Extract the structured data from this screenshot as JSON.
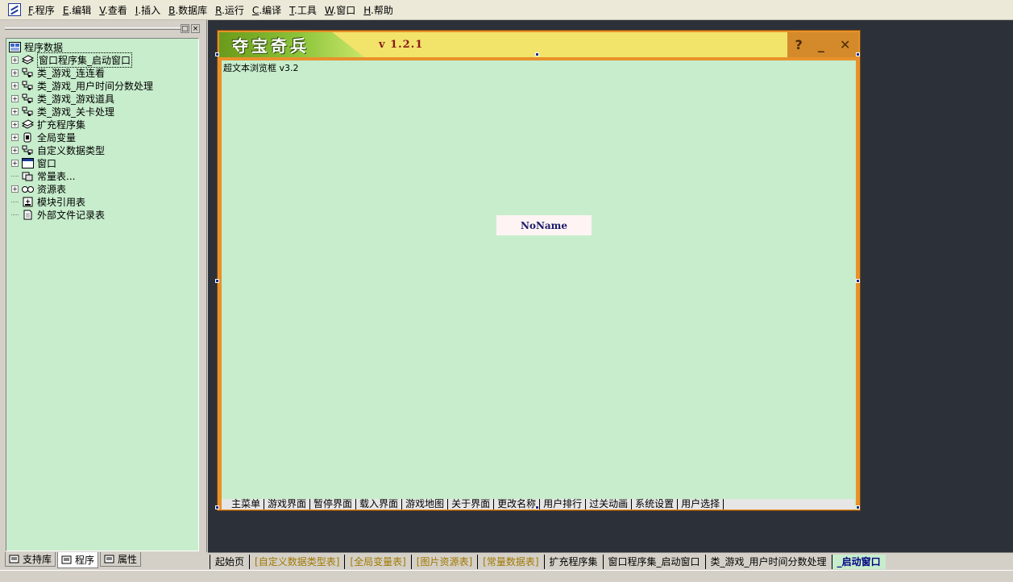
{
  "menu": {
    "items": [
      {
        "acc": "F",
        "rest": ".程序"
      },
      {
        "acc": "E",
        "rest": ".编辑"
      },
      {
        "acc": "V",
        "rest": ".查看"
      },
      {
        "acc": "I",
        "rest": ".插入"
      },
      {
        "acc": "B",
        "rest": ".数据库"
      },
      {
        "acc": "R",
        "rest": ".运行"
      },
      {
        "acc": "C",
        "rest": ".编译"
      },
      {
        "acc": "T",
        "rest": ".工具"
      },
      {
        "acc": "W",
        "rest": ".窗口"
      },
      {
        "acc": "H",
        "rest": ".帮助"
      }
    ]
  },
  "panel": {
    "pin_label": "□",
    "close_label": "×"
  },
  "tree": {
    "root": "程序数据",
    "items": [
      {
        "label": "窗口程序集_启动窗口",
        "icon": "assembly-icon",
        "expander": "+"
      },
      {
        "label": "类_游戏_连连看",
        "icon": "class-icon",
        "expander": "+"
      },
      {
        "label": "类_游戏_用户时间分数处理",
        "icon": "class-icon",
        "expander": "+"
      },
      {
        "label": "类_游戏_游戏道具",
        "icon": "class-icon",
        "expander": "+"
      },
      {
        "label": "类_游戏_关卡处理",
        "icon": "class-icon",
        "expander": "+"
      },
      {
        "label": "扩充程序集",
        "icon": "assembly-icon",
        "expander": "+"
      },
      {
        "label": "全局变量",
        "icon": "variable-icon",
        "expander": "+"
      },
      {
        "label": "自定义数据类型",
        "icon": "class-icon",
        "expander": "+"
      },
      {
        "label": "窗口",
        "icon": "window-icon",
        "expander": "+"
      },
      {
        "label": "常量表...",
        "icon": "constant-icon",
        "expander": ""
      },
      {
        "label": "资源表",
        "icon": "resource-icon",
        "expander": "+"
      },
      {
        "label": "模块引用表",
        "icon": "module-icon",
        "expander": ""
      },
      {
        "label": "外部文件记录表",
        "icon": "file-icon",
        "expander": ""
      }
    ]
  },
  "left_tabs": [
    {
      "label": "支持库",
      "active": false
    },
    {
      "label": "程序",
      "active": true
    },
    {
      "label": "属性",
      "active": false
    }
  ],
  "form": {
    "logo_text": "夺宝奇兵",
    "version": "v 1.2.1",
    "help": "?",
    "minimize": "_",
    "close": "✕",
    "browser_label": "超文本浏览框 v3.2",
    "noname": "NoName",
    "tabs": [
      "主菜单",
      "游戏界面",
      "暂停界面",
      "载入界面",
      "游戏地图",
      "关于界面",
      "更改名称",
      "用户排行",
      "过关动画",
      "系统设置",
      "用户选择"
    ]
  },
  "doc_tabs": [
    {
      "label": "起始页",
      "style": "normal"
    },
    {
      "label": "[自定义数据类型表]",
      "style": "yellow"
    },
    {
      "label": "[全局变量表]",
      "style": "yellow"
    },
    {
      "label": "[图片资源表]",
      "style": "yellow"
    },
    {
      "label": "[常量数据表]",
      "style": "yellow"
    },
    {
      "label": "扩充程序集",
      "style": "normal"
    },
    {
      "label": "窗口程序集_启动窗口",
      "style": "normal"
    },
    {
      "label": "类_游戏_用户时间分数处理",
      "style": "normal"
    },
    {
      "label": "_启动窗口",
      "style": "active"
    }
  ],
  "colors": {
    "tree_bg": "#c7edcc",
    "workspace_bg": "#2c3139",
    "form_frame": "#e8912a",
    "active_tab": "#000080"
  }
}
